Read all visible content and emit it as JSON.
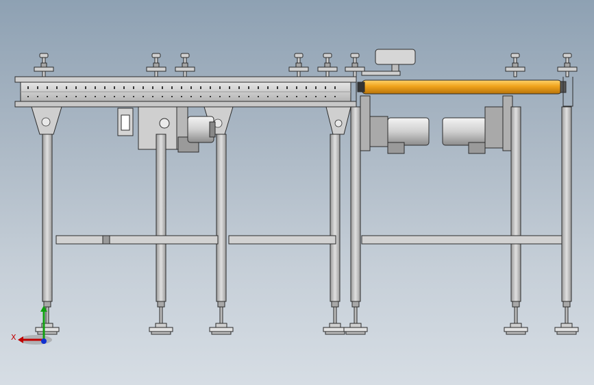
{
  "view": {
    "background_top": "#8ea1b3",
    "background_bottom": "#d6dde4"
  },
  "model": {
    "frame_color": "#bfbfbf",
    "frame_edge_color": "#2b2b2b",
    "roller_color": "#f0a31c",
    "motor_color": "#d8d8d8"
  },
  "triad": {
    "x_label": "X",
    "x_color": "#c00000",
    "y_color": "#10a010",
    "z_color": "#1030d0"
  }
}
